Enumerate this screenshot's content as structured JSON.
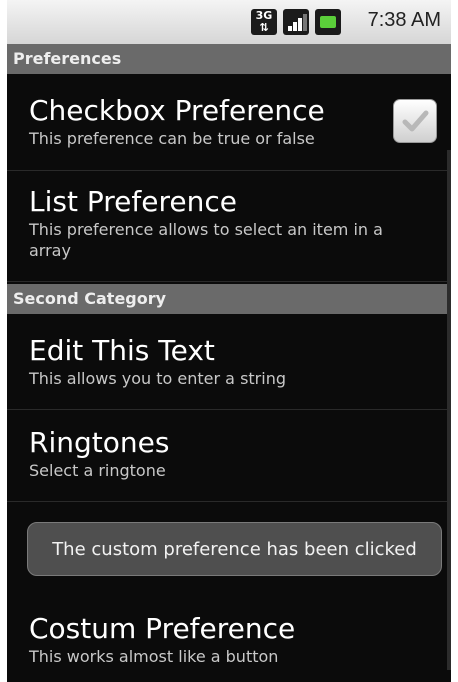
{
  "status_bar": {
    "network_icon": "3g-icon",
    "network_label_top": "3G",
    "network_label_bottom": "⇅",
    "signal_icon": "signal-icon",
    "battery_icon": "battery-icon",
    "time": "7:38 AM"
  },
  "categories": [
    {
      "title": "Preferences"
    },
    {
      "title": "Second Category"
    }
  ],
  "preferences": [
    {
      "title": "Checkbox Preference",
      "summary": "This preference can be true or false",
      "checked": true
    },
    {
      "title": "List Preference",
      "summary_line1": "This preference allows to select an item in a",
      "summary_line2": "array"
    },
    {
      "title": "Edit This Text",
      "summary": "This allows you to enter a string"
    },
    {
      "title": "Ringtones",
      "summary": "Select a ringtone"
    },
    {
      "title": "Costum Preference",
      "summary": "This works almost like a button"
    }
  ],
  "toast": {
    "message": "The custom preference has been clicked"
  }
}
